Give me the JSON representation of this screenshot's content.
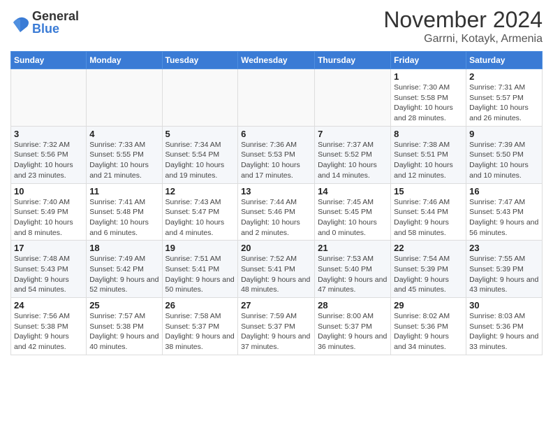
{
  "header": {
    "logo_general": "General",
    "logo_blue": "Blue",
    "title": "November 2024",
    "subtitle": "Garrni, Kotayk, Armenia"
  },
  "weekdays": [
    "Sunday",
    "Monday",
    "Tuesday",
    "Wednesday",
    "Thursday",
    "Friday",
    "Saturday"
  ],
  "weeks": [
    [
      {
        "day": "",
        "info": ""
      },
      {
        "day": "",
        "info": ""
      },
      {
        "day": "",
        "info": ""
      },
      {
        "day": "",
        "info": ""
      },
      {
        "day": "",
        "info": ""
      },
      {
        "day": "1",
        "info": "Sunrise: 7:30 AM\nSunset: 5:58 PM\nDaylight: 10 hours and 28 minutes."
      },
      {
        "day": "2",
        "info": "Sunrise: 7:31 AM\nSunset: 5:57 PM\nDaylight: 10 hours and 26 minutes."
      }
    ],
    [
      {
        "day": "3",
        "info": "Sunrise: 7:32 AM\nSunset: 5:56 PM\nDaylight: 10 hours and 23 minutes."
      },
      {
        "day": "4",
        "info": "Sunrise: 7:33 AM\nSunset: 5:55 PM\nDaylight: 10 hours and 21 minutes."
      },
      {
        "day": "5",
        "info": "Sunrise: 7:34 AM\nSunset: 5:54 PM\nDaylight: 10 hours and 19 minutes."
      },
      {
        "day": "6",
        "info": "Sunrise: 7:36 AM\nSunset: 5:53 PM\nDaylight: 10 hours and 17 minutes."
      },
      {
        "day": "7",
        "info": "Sunrise: 7:37 AM\nSunset: 5:52 PM\nDaylight: 10 hours and 14 minutes."
      },
      {
        "day": "8",
        "info": "Sunrise: 7:38 AM\nSunset: 5:51 PM\nDaylight: 10 hours and 12 minutes."
      },
      {
        "day": "9",
        "info": "Sunrise: 7:39 AM\nSunset: 5:50 PM\nDaylight: 10 hours and 10 minutes."
      }
    ],
    [
      {
        "day": "10",
        "info": "Sunrise: 7:40 AM\nSunset: 5:49 PM\nDaylight: 10 hours and 8 minutes."
      },
      {
        "day": "11",
        "info": "Sunrise: 7:41 AM\nSunset: 5:48 PM\nDaylight: 10 hours and 6 minutes."
      },
      {
        "day": "12",
        "info": "Sunrise: 7:43 AM\nSunset: 5:47 PM\nDaylight: 10 hours and 4 minutes."
      },
      {
        "day": "13",
        "info": "Sunrise: 7:44 AM\nSunset: 5:46 PM\nDaylight: 10 hours and 2 minutes."
      },
      {
        "day": "14",
        "info": "Sunrise: 7:45 AM\nSunset: 5:45 PM\nDaylight: 10 hours and 0 minutes."
      },
      {
        "day": "15",
        "info": "Sunrise: 7:46 AM\nSunset: 5:44 PM\nDaylight: 9 hours and 58 minutes."
      },
      {
        "day": "16",
        "info": "Sunrise: 7:47 AM\nSunset: 5:43 PM\nDaylight: 9 hours and 56 minutes."
      }
    ],
    [
      {
        "day": "17",
        "info": "Sunrise: 7:48 AM\nSunset: 5:43 PM\nDaylight: 9 hours and 54 minutes."
      },
      {
        "day": "18",
        "info": "Sunrise: 7:49 AM\nSunset: 5:42 PM\nDaylight: 9 hours and 52 minutes."
      },
      {
        "day": "19",
        "info": "Sunrise: 7:51 AM\nSunset: 5:41 PM\nDaylight: 9 hours and 50 minutes."
      },
      {
        "day": "20",
        "info": "Sunrise: 7:52 AM\nSunset: 5:41 PM\nDaylight: 9 hours and 48 minutes."
      },
      {
        "day": "21",
        "info": "Sunrise: 7:53 AM\nSunset: 5:40 PM\nDaylight: 9 hours and 47 minutes."
      },
      {
        "day": "22",
        "info": "Sunrise: 7:54 AM\nSunset: 5:39 PM\nDaylight: 9 hours and 45 minutes."
      },
      {
        "day": "23",
        "info": "Sunrise: 7:55 AM\nSunset: 5:39 PM\nDaylight: 9 hours and 43 minutes."
      }
    ],
    [
      {
        "day": "24",
        "info": "Sunrise: 7:56 AM\nSunset: 5:38 PM\nDaylight: 9 hours and 42 minutes."
      },
      {
        "day": "25",
        "info": "Sunrise: 7:57 AM\nSunset: 5:38 PM\nDaylight: 9 hours and 40 minutes."
      },
      {
        "day": "26",
        "info": "Sunrise: 7:58 AM\nSunset: 5:37 PM\nDaylight: 9 hours and 38 minutes."
      },
      {
        "day": "27",
        "info": "Sunrise: 7:59 AM\nSunset: 5:37 PM\nDaylight: 9 hours and 37 minutes."
      },
      {
        "day": "28",
        "info": "Sunrise: 8:00 AM\nSunset: 5:37 PM\nDaylight: 9 hours and 36 minutes."
      },
      {
        "day": "29",
        "info": "Sunrise: 8:02 AM\nSunset: 5:36 PM\nDaylight: 9 hours and 34 minutes."
      },
      {
        "day": "30",
        "info": "Sunrise: 8:03 AM\nSunset: 5:36 PM\nDaylight: 9 hours and 33 minutes."
      }
    ]
  ]
}
